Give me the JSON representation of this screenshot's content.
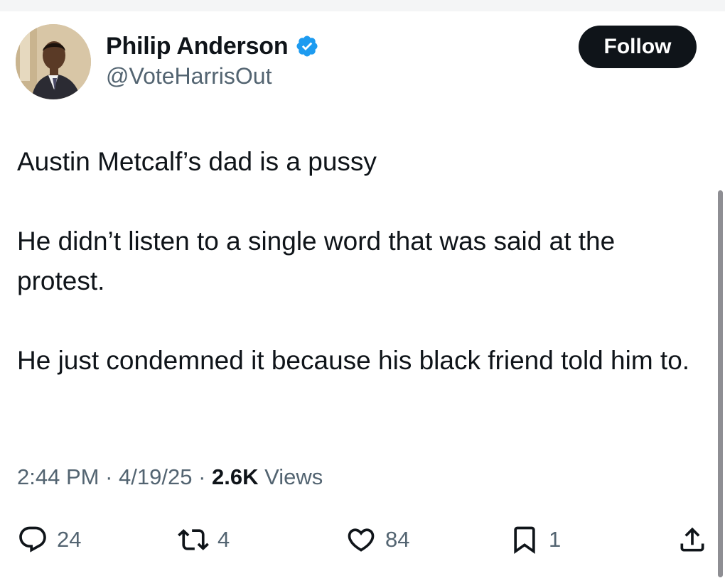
{
  "user": {
    "display_name": "Philip Anderson",
    "handle": "@VoteHarrisOut",
    "verified": true
  },
  "follow_label": "Follow",
  "tweet": {
    "paragraphs": [
      "Austin Metcalf’s dad is a pussy",
      "He didn’t listen to a single word that was said at the protest.",
      "He just condemned it because his black friend told him to."
    ]
  },
  "meta": {
    "time": "2:44 PM",
    "date": "4/19/25",
    "views_count": "2.6K",
    "views_label": "Views"
  },
  "actions": {
    "replies": "24",
    "reposts": "4",
    "likes": "84",
    "bookmarks": "1"
  },
  "colors": {
    "text": "#0f1419",
    "secondary": "#536471",
    "verified": "#1d9bf0",
    "follow_bg": "#0f1419"
  },
  "icons": [
    "verified-badge-icon",
    "reply-icon",
    "repost-icon",
    "like-icon",
    "bookmark-icon",
    "share-icon"
  ]
}
